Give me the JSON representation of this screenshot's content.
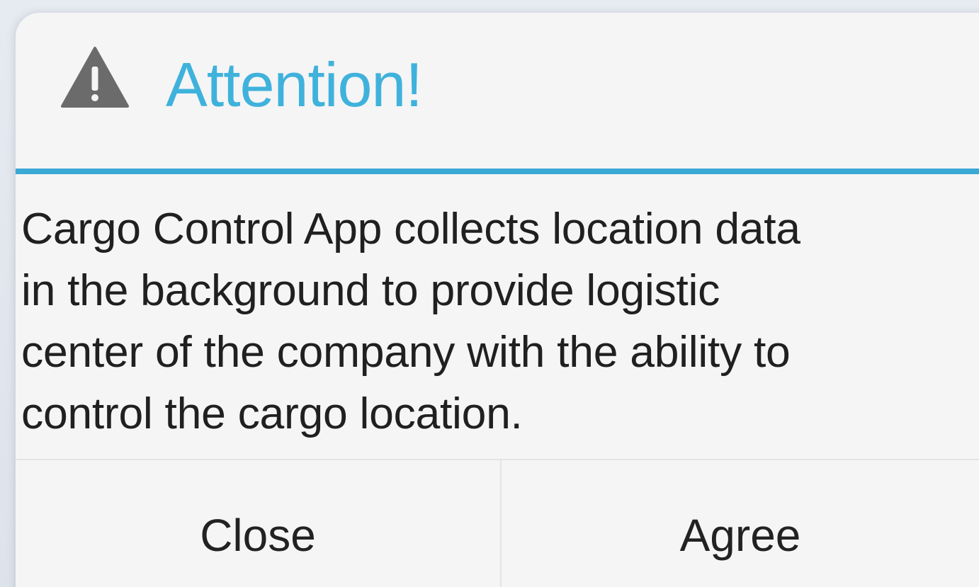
{
  "dialog": {
    "title": "Attention!",
    "icon": "warning-triangle-icon",
    "message": "Cargo Control App collects location data\nin the background to provide logistic\ncenter of the company with the ability to\ncontrol the cargo location.",
    "buttons": {
      "close_label": "Close",
      "agree_label": "Agree"
    }
  },
  "colors": {
    "accent": "#3fb2dc",
    "divider": "#3aa9d6",
    "dialog_background": "#f5f5f5",
    "icon": "#6b6b6b",
    "text": "#202020"
  }
}
